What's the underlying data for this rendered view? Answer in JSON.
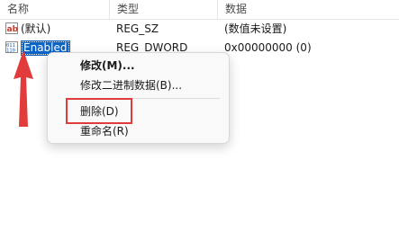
{
  "columns": {
    "name": "名称",
    "type": "类型",
    "data": "数据"
  },
  "rows": [
    {
      "name": "(默认)",
      "type": "REG_SZ",
      "data": "(数值未设置)",
      "icon": "string-value-icon"
    },
    {
      "name": "Enabled",
      "type": "REG_DWORD",
      "data": "0x00000000 (0)",
      "icon": "binary-value-icon",
      "selected": true
    }
  ],
  "context_menu": {
    "items": [
      {
        "label": "修改(M)...",
        "default": true
      },
      {
        "label": "修改二进制数据(B)..."
      },
      {
        "label": "删除(D)",
        "highlighted": true
      },
      {
        "label": "重命名(R)"
      }
    ]
  },
  "colors": {
    "selection": "#0a64c8",
    "annotation_red": "#e23b3b",
    "string_icon": "#c8392b",
    "binary_icon": "#1f5fa8"
  },
  "icons": [
    "string-value-icon",
    "binary-value-icon",
    "annotation-arrow-icon"
  ]
}
